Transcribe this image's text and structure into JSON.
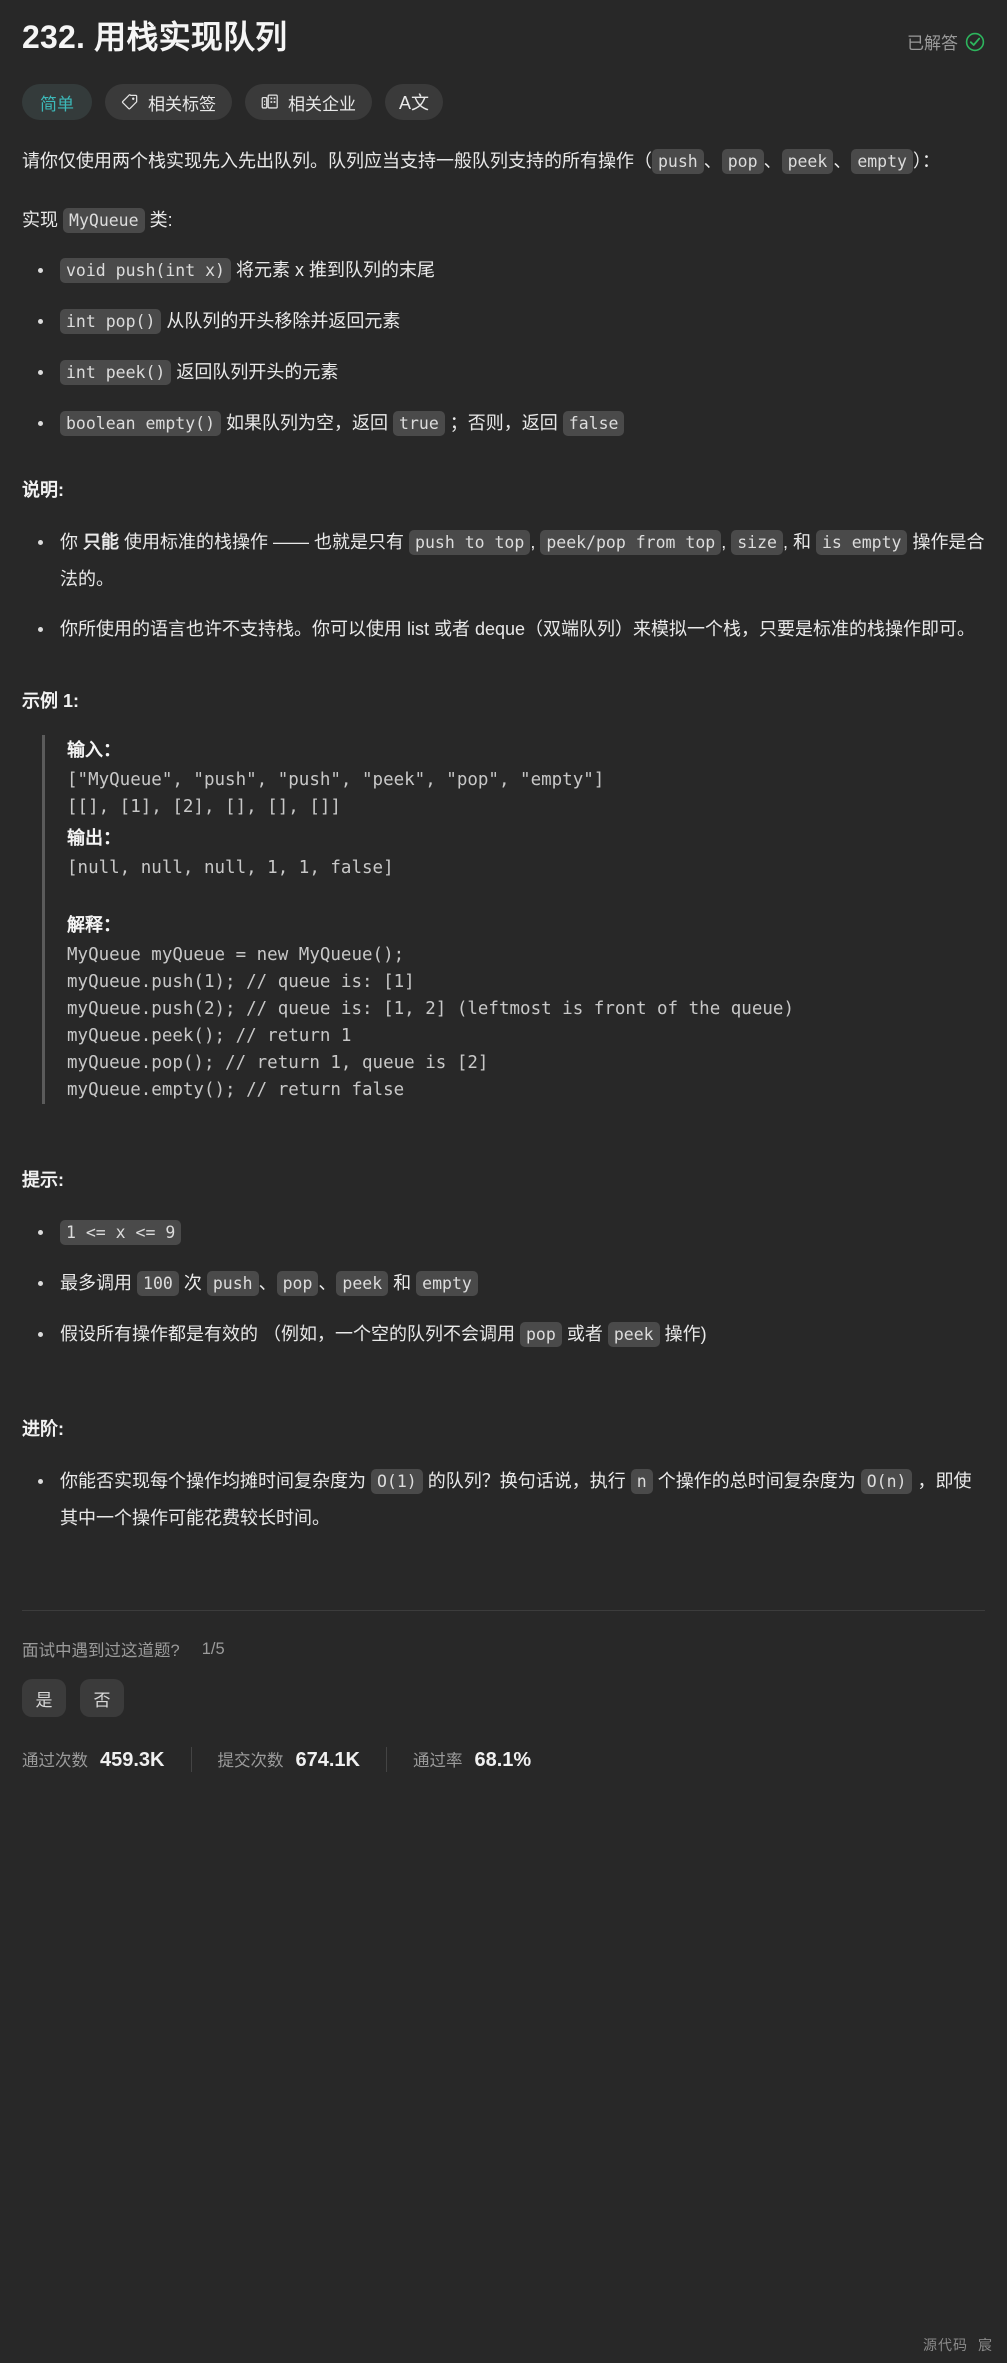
{
  "header": {
    "title": "232. 用栈实现队列",
    "solved_label": "已解答",
    "solved_icon": "check-circle-icon",
    "solved_color": "#2db55d"
  },
  "chips": {
    "difficulty": {
      "label": "简单",
      "color": "#3cb8b8"
    },
    "topics": {
      "label": "相关标签",
      "icon": "tag-icon"
    },
    "companies": {
      "label": "相关企业",
      "icon": "building-icon"
    },
    "translate": {
      "label": "A文",
      "icon": "translate-icon"
    }
  },
  "description": {
    "intro_1": "请你仅使用两个栈实现先入先出队列。队列应当支持一般队列支持的所有操作（",
    "code_push": "push",
    "sep_1": "、",
    "code_pop": "pop",
    "sep_2": "、",
    "code_peek": "peek",
    "sep_3": "、",
    "code_empty": "empty",
    "intro_2": "）：",
    "implement_prefix": "实现 ",
    "implement_class": "MyQueue",
    "implement_suffix": " 类:",
    "methods": [
      {
        "code": "void push(int x)",
        "text": " 将元素 x 推到队列的末尾"
      },
      {
        "code": "int pop()",
        "text": " 从队列的开头移除并返回元素"
      },
      {
        "code": "int peek()",
        "text": " 返回队列开头的元素"
      }
    ],
    "method_empty": {
      "code": "boolean empty()",
      "text_1": " 如果队列为空，返回 ",
      "code_true": "true",
      "text_2": " ；否则，返回 ",
      "code_false": "false"
    }
  },
  "notes": {
    "title": "说明:",
    "item1": {
      "t1": "你 ",
      "bold": "只能",
      "t2": " 使用标准的栈操作 —— 也就是只有 ",
      "c1": "push to top",
      "t3": ", ",
      "c2": "peek/pop from top",
      "t4": ", ",
      "c3": "size",
      "t5": ", 和 ",
      "c4": "is empty",
      "t6": " 操作是合法的。"
    },
    "item2": "你所使用的语言也许不支持栈。你可以使用 list 或者 deque（双端队列）来模拟一个栈，只要是标准的栈操作即可。"
  },
  "example": {
    "label": "示例 1:",
    "input_label": "输入：",
    "input_code": "[\"MyQueue\", \"push\", \"push\", \"peek\", \"pop\", \"empty\"]\n[[], [1], [2], [], [], []]",
    "output_label": "输出：",
    "output_code": "[null, null, null, 1, 1, false]",
    "explain_label": "解释：",
    "explain_code": "MyQueue myQueue = new MyQueue();\nmyQueue.push(1); // queue is: [1]\nmyQueue.push(2); // queue is: [1, 2] (leftmost is front of the queue)\nmyQueue.peek(); // return 1\nmyQueue.pop(); // return 1, queue is [2]\nmyQueue.empty(); // return false"
  },
  "constraints": {
    "title": "提示:",
    "item1_code": "1 <= x <= 9",
    "item2": {
      "t1": "最多调用 ",
      "c1": "100",
      "t2": " 次 ",
      "c2": "push",
      "t3": "、",
      "c3": "pop",
      "t4": "、",
      "c4": "peek",
      "t5": " 和 ",
      "c5": "empty"
    },
    "item3": {
      "t1": "假设所有操作都是有效的 （例如，一个空的队列不会调用 ",
      "c1": "pop",
      "t2": " 或者 ",
      "c2": "peek",
      "t3": " 操作)"
    }
  },
  "followup": {
    "title": "进阶:",
    "item": {
      "t1": "你能否实现每个操作均摊时间复杂度为 ",
      "c1": "O(1)",
      "t2": " 的队列？换句话说，执行 ",
      "c2": "n",
      "t3": " 个操作的总时间复杂度为 ",
      "c3": "O(n)",
      "t4": " ，即使其中一个操作可能花费较长时间。"
    }
  },
  "footer": {
    "interview_question": "面试中遇到过这道题?",
    "interview_count": "1/5",
    "yes_label": "是",
    "no_label": "否",
    "stats": [
      {
        "label": "通过次数",
        "value": "459.3K"
      },
      {
        "label": "提交次数",
        "value": "674.1K"
      },
      {
        "label": "通过率",
        "value": "68.1%"
      }
    ],
    "watermark_1": "源代码",
    "watermark_2": "宸"
  }
}
